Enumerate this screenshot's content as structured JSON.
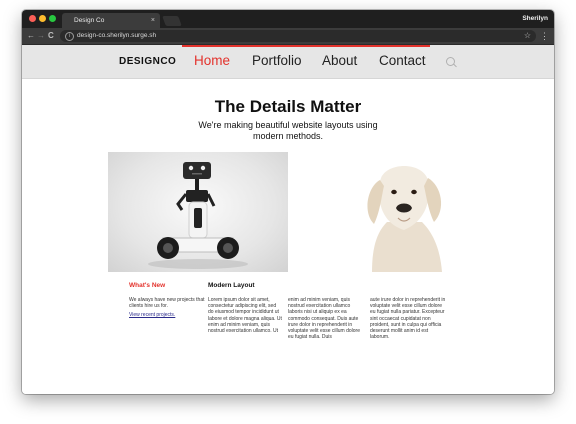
{
  "browser": {
    "tab_title": "Design Co",
    "tab_close": "×",
    "user_name": "Sherilyn",
    "url": "design-co.sherilyn.surge.sh",
    "nav_back": "←",
    "nav_forward": "→",
    "nav_reload": "C",
    "star": "☆",
    "menu": "⋮",
    "info": "i"
  },
  "site": {
    "logo": "DESIGNCO",
    "nav": [
      "Home",
      "Portfolio",
      "About",
      "Contact"
    ],
    "active_index": 0,
    "accent": "#e3322c",
    "title": "The Details Matter",
    "subtitle": "We're making beautiful website layouts using modern methods.",
    "images": [
      "robot-photo",
      "dog-photo"
    ]
  },
  "whats_new": {
    "heading": "What's New",
    "text": "We always have new projects that clients hire us for.",
    "link": "View recent projects."
  },
  "modern_layout": {
    "heading": "Modern Layout",
    "col1": "Lorem ipsum dolor sit amet, consectetur adipiscing elit, sed do eiusmod tempor incididunt ut labore et dolore magna aliqua. Ut enim ad minim veniam, quis nostrud exercitation ullamco. Ut",
    "col2": "enim ad minim veniam, quis nostrud exercitation ullamco laboris nisi ut aliquip ex ea commodo consequat. Duis aute irure dolor in reprehenderit in voluptate velit esse cillum dolore eu fugiat nulla. Duis",
    "col3": "aute irure dolor in reprehenderit in voluptate velit esse cillum dolore eu fugiat nulla pariatur. Excepteur sint occaecat cupidatat non proident, sunt in culpa qui officia deserunt mollit anim id est laborum."
  }
}
